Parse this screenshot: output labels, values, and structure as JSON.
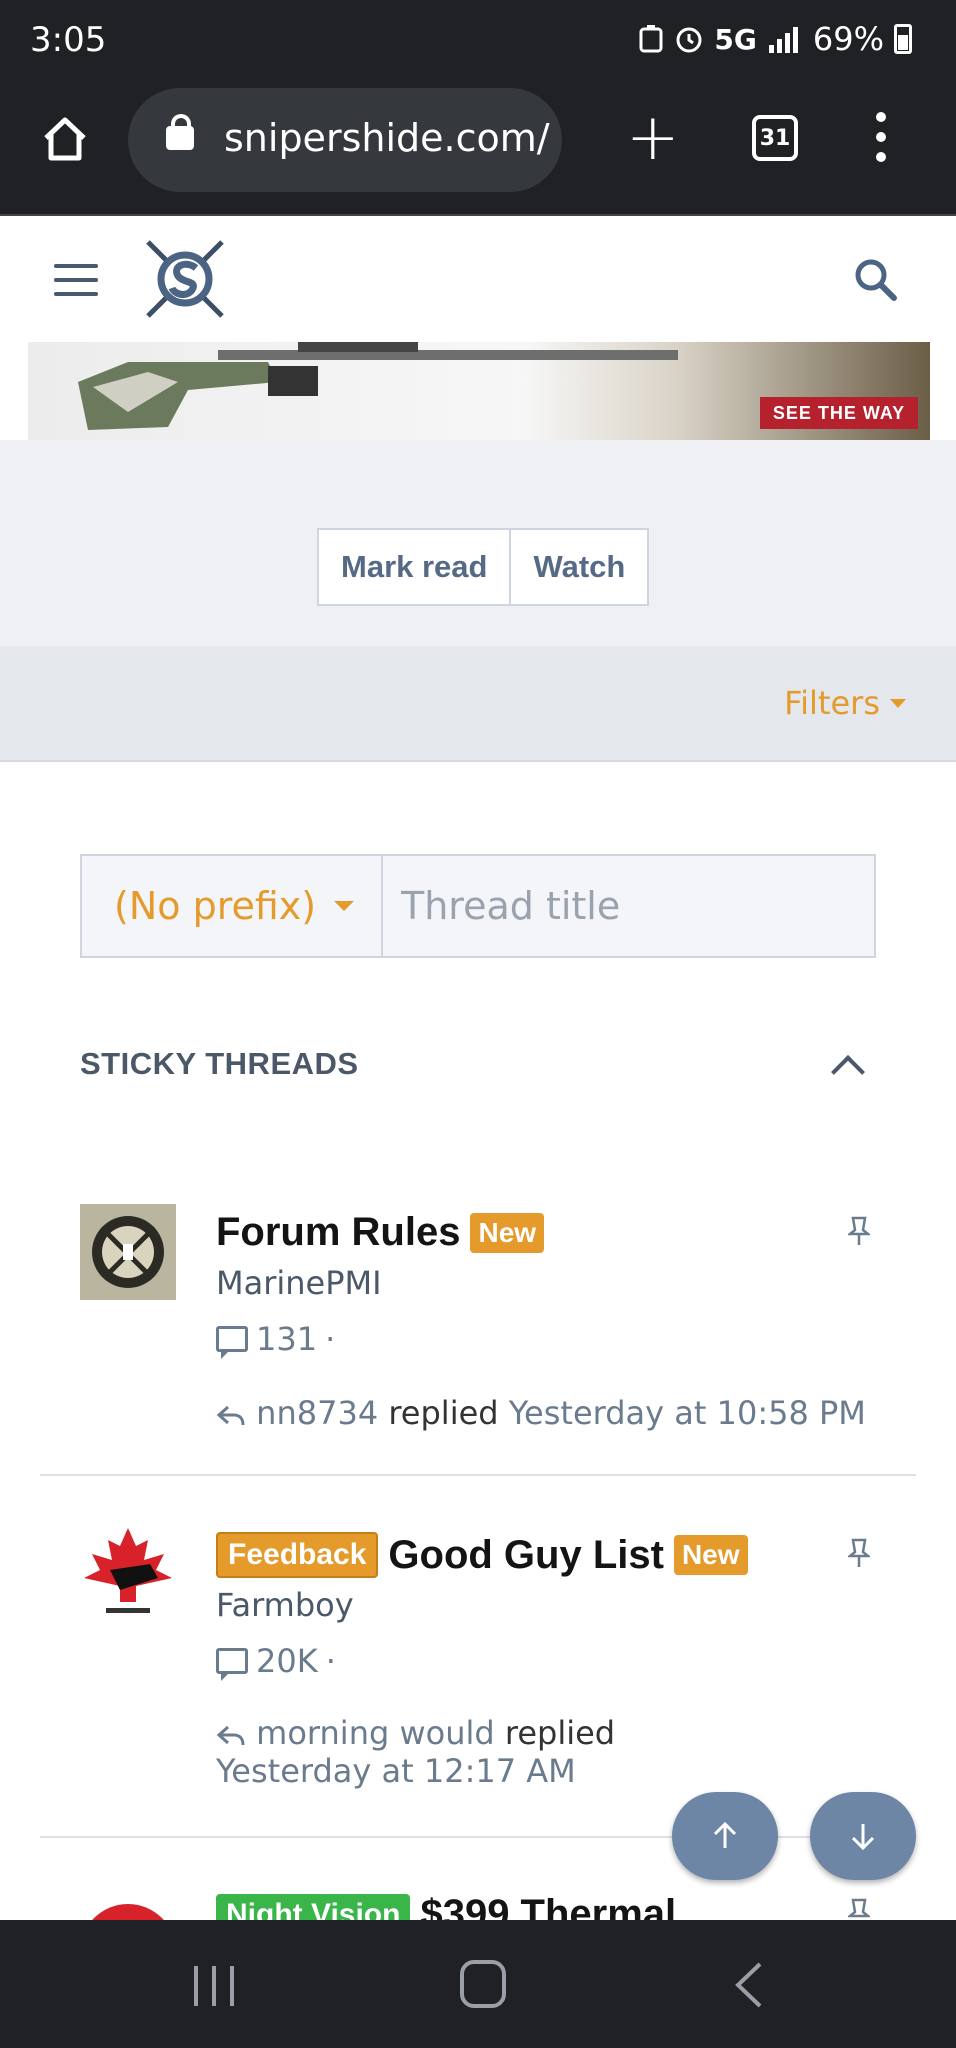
{
  "status_bar": {
    "time": "3:05",
    "network": "5G",
    "battery": "69%"
  },
  "browser": {
    "url": "snipershide.com/",
    "tab_count": "31"
  },
  "banner": {
    "cta": "SEE THE WAY"
  },
  "actions": {
    "mark_read": "Mark read",
    "watch": "Watch"
  },
  "filters": {
    "label": "Filters"
  },
  "quick_thread": {
    "prefix": "(No prefix)",
    "title_placeholder": "Thread title"
  },
  "sticky": {
    "heading": "STICKY THREADS",
    "threads": [
      {
        "title": "Forum Rules",
        "badge": "New",
        "author": "MarinePMI",
        "replies": "131",
        "last_user": "nn8734",
        "replied_label": "replied",
        "last_time": "Yesterday at 10:58 PM"
      },
      {
        "prefix": "Feedback",
        "prefix_color": "#e59b2c",
        "title": "Good Guy List",
        "badge": "New",
        "author": "Farmboy",
        "replies": "20K",
        "last_user": "morning would",
        "replied_label": "replied",
        "last_time": "Yesterday at 12:17 AM"
      },
      {
        "prefix": "Night Vision",
        "prefix_color": "#3ab54a",
        "title": "$399 Thermal"
      }
    ]
  },
  "colors": {
    "accent": "#e59b2c",
    "slate": "#566a86",
    "fab": "#6e86a6"
  }
}
